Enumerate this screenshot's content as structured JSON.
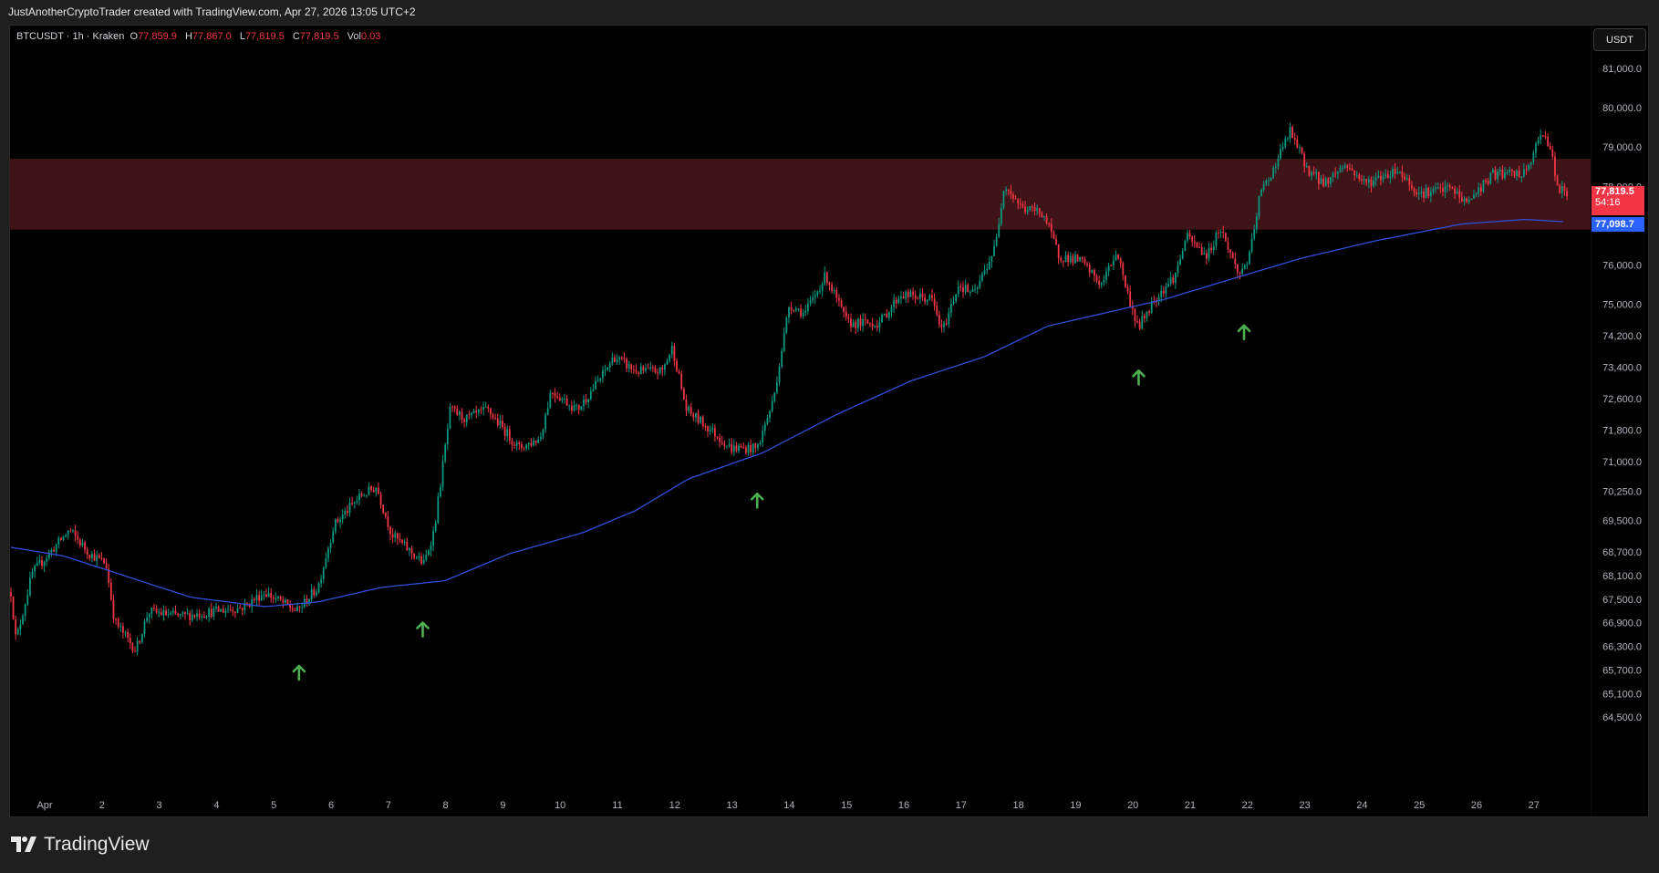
{
  "header": {
    "attribution": "JustAnotherCryptoTrader created with TradingView.com, Apr 27, 2026 13:05 UTC+2"
  },
  "legend": {
    "symbol": "BTCUSDT · 1h · Kraken",
    "o_label": "O",
    "o": "77,859.9",
    "h_label": "H",
    "h": "77,867.0",
    "l_label": "L",
    "l": "77,819.5",
    "c_label": "C",
    "c": "77,819.5",
    "vol_label": "Vol",
    "vol": "0.03"
  },
  "currency_button": "USDT",
  "price_label": {
    "price": "77,819.5",
    "countdown": "54:16"
  },
  "ma_label": {
    "price": "77,098.7"
  },
  "brand": "TradingView",
  "colors": {
    "up": "#089981",
    "down": "#f23645",
    "ma": "#2f4fd8",
    "zone": "#3e1418",
    "arrow": "#4caf50"
  },
  "chart_data": {
    "type": "candlestick",
    "title": "BTCUSDT 1h Kraken",
    "timeframe": "1h",
    "ylim": [
      64200,
      81500
    ],
    "xlim_days": [
      0.4,
      28.5
    ],
    "yticks": [
      "81,000.0",
      "80,000.0",
      "79,000.0",
      "78,000.0",
      "76,000.0",
      "75,000.0",
      "74,200.0",
      "73,400.0",
      "72,600.0",
      "71,800.0",
      "71,000.0",
      "70,250.0",
      "69,500.0",
      "68,700.0",
      "68,100.0",
      "67,500.0",
      "66,900.0",
      "66,300.0",
      "65,700.0",
      "65,100.0",
      "64,500.0"
    ],
    "xticks": [
      {
        "day": 1,
        "label": "Apr"
      },
      {
        "day": 2,
        "label": "2"
      },
      {
        "day": 3,
        "label": "3"
      },
      {
        "day": 4,
        "label": "4"
      },
      {
        "day": 5,
        "label": "5"
      },
      {
        "day": 6,
        "label": "6"
      },
      {
        "day": 7,
        "label": "7"
      },
      {
        "day": 8,
        "label": "8"
      },
      {
        "day": 9,
        "label": "9"
      },
      {
        "day": 10,
        "label": "10"
      },
      {
        "day": 11,
        "label": "11"
      },
      {
        "day": 12,
        "label": "12"
      },
      {
        "day": 13,
        "label": "13"
      },
      {
        "day": 14,
        "label": "14"
      },
      {
        "day": 15,
        "label": "15"
      },
      {
        "day": 16,
        "label": "16"
      },
      {
        "day": 17,
        "label": "17"
      },
      {
        "day": 18,
        "label": "18"
      },
      {
        "day": 19,
        "label": "19"
      },
      {
        "day": 20,
        "label": "20"
      },
      {
        "day": 21,
        "label": "21"
      },
      {
        "day": 22,
        "label": "22"
      },
      {
        "day": 23,
        "label": "23"
      },
      {
        "day": 24,
        "label": "24"
      },
      {
        "day": 25,
        "label": "25"
      },
      {
        "day": 26,
        "label": "26"
      },
      {
        "day": 27,
        "label": "27"
      }
    ],
    "price_path": [
      [
        0.41,
        67675
      ],
      [
        0.5,
        66450
      ],
      [
        0.78,
        68160
      ],
      [
        1.43,
        69260
      ],
      [
        1.79,
        68650
      ],
      [
        2.07,
        68400
      ],
      [
        2.22,
        66940
      ],
      [
        2.59,
        66200
      ],
      [
        2.81,
        67190
      ],
      [
        3.37,
        67060
      ],
      [
        4.47,
        67300
      ],
      [
        4.84,
        67680
      ],
      [
        5.4,
        67190
      ],
      [
        5.77,
        67800
      ],
      [
        6.05,
        69390
      ],
      [
        6.51,
        70120
      ],
      [
        6.79,
        70360
      ],
      [
        7.06,
        69140
      ],
      [
        7.62,
        68400
      ],
      [
        7.8,
        69260
      ],
      [
        8.08,
        72320
      ],
      [
        8.36,
        72080
      ],
      [
        8.73,
        72320
      ],
      [
        9.28,
        71340
      ],
      [
        9.65,
        71590
      ],
      [
        9.84,
        72810
      ],
      [
        10.3,
        72320
      ],
      [
        10.67,
        73050
      ],
      [
        10.94,
        73670
      ],
      [
        11.31,
        73300
      ],
      [
        11.78,
        73300
      ],
      [
        11.96,
        73910
      ],
      [
        12.2,
        72320
      ],
      [
        12.61,
        71830
      ],
      [
        12.98,
        71340
      ],
      [
        13.44,
        71340
      ],
      [
        13.72,
        72560
      ],
      [
        14.0,
        75010
      ],
      [
        14.27,
        74760
      ],
      [
        14.64,
        75740
      ],
      [
        15.01,
        74520
      ],
      [
        15.57,
        74520
      ],
      [
        15.94,
        75250
      ],
      [
        16.49,
        75130
      ],
      [
        16.67,
        74280
      ],
      [
        16.95,
        75500
      ],
      [
        17.23,
        75250
      ],
      [
        17.6,
        76480
      ],
      [
        17.75,
        78070
      ],
      [
        18.06,
        77450
      ],
      [
        18.43,
        77330
      ],
      [
        18.71,
        76230
      ],
      [
        19.08,
        76110
      ],
      [
        19.45,
        75500
      ],
      [
        19.72,
        76360
      ],
      [
        19.91,
        75250
      ],
      [
        20.09,
        74400
      ],
      [
        20.37,
        75130
      ],
      [
        20.74,
        75740
      ],
      [
        20.93,
        76720
      ],
      [
        21.3,
        76230
      ],
      [
        21.52,
        76970
      ],
      [
        21.85,
        75740
      ],
      [
        22.04,
        76230
      ],
      [
        22.22,
        77820
      ],
      [
        22.41,
        78310
      ],
      [
        22.74,
        79410
      ],
      [
        23.05,
        78430
      ],
      [
        23.33,
        78070
      ],
      [
        23.7,
        78560
      ],
      [
        24.07,
        78070
      ],
      [
        24.62,
        78430
      ],
      [
        24.99,
        77820
      ],
      [
        25.55,
        77950
      ],
      [
        25.82,
        77580
      ],
      [
        26.29,
        78310
      ],
      [
        26.84,
        78310
      ],
      [
        27.16,
        79410
      ],
      [
        27.3,
        78920
      ],
      [
        27.4,
        77950
      ],
      [
        27.58,
        77820
      ]
    ],
    "moving_average": [
      [
        0.41,
        68820
      ],
      [
        1.33,
        68600
      ],
      [
        2.26,
        68160
      ],
      [
        3.55,
        67550
      ],
      [
        4.84,
        67310
      ],
      [
        5.77,
        67430
      ],
      [
        6.88,
        67800
      ],
      [
        7.99,
        67970
      ],
      [
        9.1,
        68650
      ],
      [
        10.39,
        69190
      ],
      [
        11.31,
        69750
      ],
      [
        12.24,
        70560
      ],
      [
        13.53,
        71220
      ],
      [
        14.83,
        72200
      ],
      [
        16.12,
        73050
      ],
      [
        17.41,
        73670
      ],
      [
        18.52,
        74450
      ],
      [
        19.63,
        74820
      ],
      [
        20.56,
        75130
      ],
      [
        21.67,
        75620
      ],
      [
        22.96,
        76180
      ],
      [
        24.25,
        76620
      ],
      [
        25.73,
        77040
      ],
      [
        26.84,
        77160
      ],
      [
        27.54,
        77099
      ]
    ],
    "resistance_zone": [
      76900,
      78700
    ],
    "arrows": [
      {
        "day": 5.44,
        "price": 65640
      },
      {
        "day": 7.6,
        "price": 66740
      },
      {
        "day": 13.44,
        "price": 70020
      },
      {
        "day": 20.1,
        "price": 73150
      },
      {
        "day": 21.94,
        "price": 74300
      }
    ],
    "last_price": 77819.5,
    "ma_last": 77098.7
  }
}
